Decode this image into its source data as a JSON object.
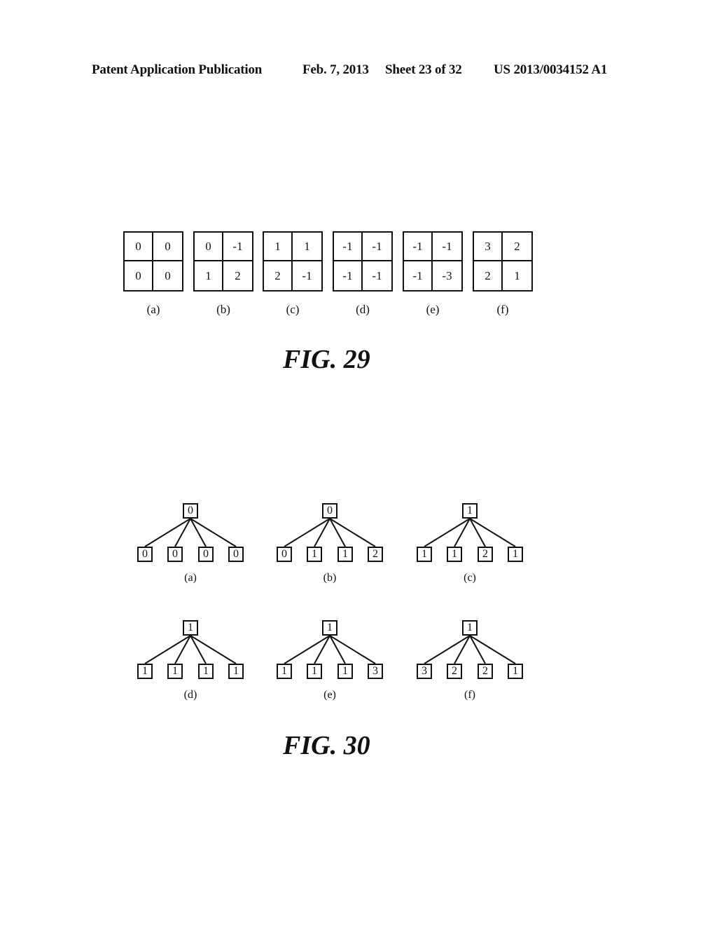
{
  "header": {
    "publication": "Patent Application Publication",
    "date": "Feb. 7, 2013",
    "sheet": "Sheet 23 of 32",
    "number": "US 2013/0034152 A1"
  },
  "fig29": {
    "title": "FIG. 29",
    "panels": [
      {
        "label": "(a)",
        "cells": [
          "0",
          "0",
          "0",
          "0"
        ]
      },
      {
        "label": "(b)",
        "cells": [
          "0",
          "-1",
          "1",
          "2"
        ]
      },
      {
        "label": "(c)",
        "cells": [
          "1",
          "1",
          "2",
          "-1"
        ]
      },
      {
        "label": "(d)",
        "cells": [
          "-1",
          "-1",
          "-1",
          "-1"
        ]
      },
      {
        "label": "(e)",
        "cells": [
          "-1",
          "-1",
          "-1",
          "-3"
        ]
      },
      {
        "label": "(f)",
        "cells": [
          "3",
          "2",
          "2",
          "1"
        ]
      }
    ]
  },
  "fig30": {
    "title": "FIG. 30",
    "trees": [
      {
        "label": "(a)",
        "root": "0",
        "children": [
          "0",
          "0",
          "0",
          "0"
        ]
      },
      {
        "label": "(b)",
        "root": "0",
        "children": [
          "0",
          "1",
          "1",
          "2"
        ]
      },
      {
        "label": "(c)",
        "root": "1",
        "children": [
          "1",
          "1",
          "2",
          "1"
        ]
      },
      {
        "label": "(d)",
        "root": "1",
        "children": [
          "1",
          "1",
          "1",
          "1"
        ]
      },
      {
        "label": "(e)",
        "root": "1",
        "children": [
          "1",
          "1",
          "1",
          "3"
        ]
      },
      {
        "label": "(f)",
        "root": "1",
        "children": [
          "3",
          "2",
          "2",
          "1"
        ]
      }
    ]
  }
}
